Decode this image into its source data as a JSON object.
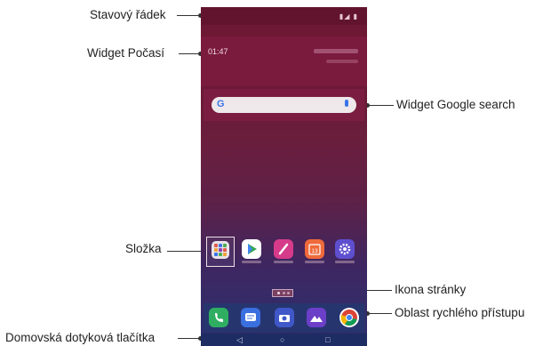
{
  "labels": {
    "status_bar": "Stavový řádek",
    "weather_widget": "Widget Počasí",
    "google_widget": "Widget Google search",
    "folder": "Složka",
    "page_icon": "Ikona stránky",
    "quick_access": "Oblast rychlého přístupu",
    "home_buttons": "Domovská dotyková tlačítka"
  },
  "phone": {
    "weather_time": "01:47",
    "search_logo": "G",
    "nav_back": "◁",
    "nav_home": "○",
    "nav_recents": "□"
  },
  "colors": {
    "wallpaper_top": "#6e1734",
    "wallpaper_bottom": "#29306f",
    "dock": "#27356f"
  },
  "apps": [
    "folder",
    "play-store",
    "notes",
    "calendar",
    "settings"
  ],
  "dock_apps": [
    "phone",
    "messages",
    "camera",
    "gallery",
    "chrome"
  ]
}
